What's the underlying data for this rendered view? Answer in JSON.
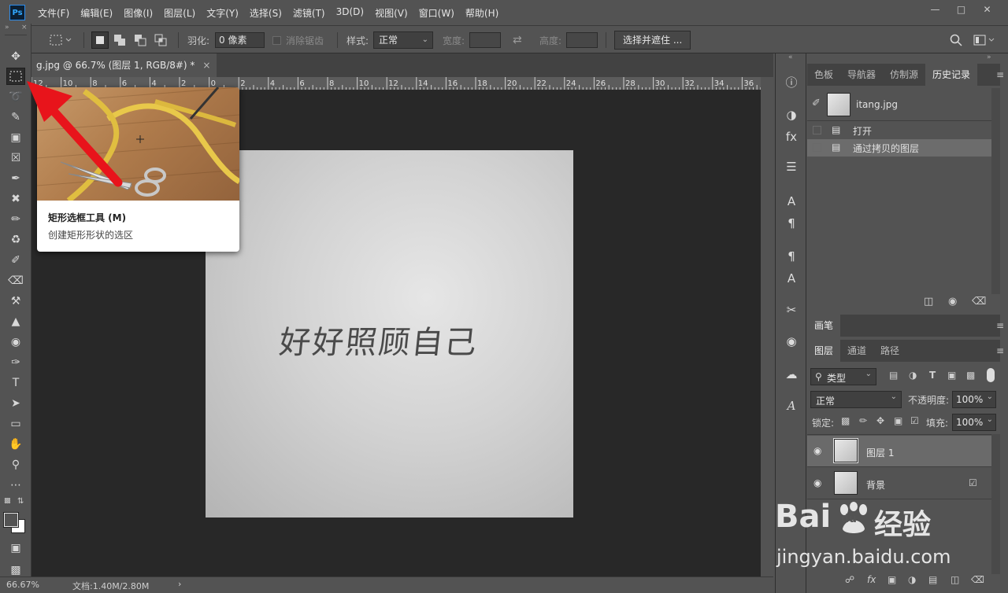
{
  "app": {
    "logo": "Ps",
    "menus": [
      "文件(F)",
      "编辑(E)",
      "图像(I)",
      "图层(L)",
      "文字(Y)",
      "选择(S)",
      "滤镜(T)",
      "3D(D)",
      "视图(V)",
      "窗口(W)",
      "帮助(H)"
    ]
  },
  "options": {
    "feather_label": "羽化:",
    "feather_value": "0 像素",
    "antialias_label": "消除锯齿",
    "style_label": "样式:",
    "style_value": "正常",
    "width_label": "宽度:",
    "height_label": "高度:",
    "select_mask_button": "选择并遮住 ..."
  },
  "document": {
    "tab_title": "g.jpg @ 66.7% (图层 1, RGB/8#) *",
    "close": "×",
    "ruler_numbers": [
      "12",
      "10",
      "8",
      "6",
      "4",
      "2",
      "0",
      "2",
      "4",
      "6",
      "8",
      "10",
      "12",
      "14",
      "16",
      "18",
      "20",
      "22",
      "24",
      "26",
      "28",
      "30",
      "32",
      "34",
      "36"
    ],
    "image_text": "好好照顾自己"
  },
  "tooltip": {
    "title": "矩形选框工具 (M)",
    "description": "创建矩形形状的选区"
  },
  "status": {
    "zoom": "66.67%",
    "doc_info": "文档:1.40M/2.80M"
  },
  "history_panel": {
    "tabs": [
      "色板",
      "导航器",
      "仿制源",
      "历史记录"
    ],
    "active_tab": "历史记录",
    "snapshot_name": "itang.jpg",
    "entries": [
      "打开",
      "通过拷贝的图层"
    ]
  },
  "brush_panel": {
    "tab": "画笔"
  },
  "layers_panel": {
    "tabs": [
      "图层",
      "通道",
      "路径"
    ],
    "filter_label": "类型",
    "blend_mode": "正常",
    "opacity_label": "不透明度:",
    "opacity_value": "100%",
    "lock_label": "锁定:",
    "fill_label": "填充:",
    "fill_value": "100%",
    "layers": [
      {
        "name": "图层 1",
        "locked": false
      },
      {
        "name": "背景",
        "locked": true
      }
    ]
  },
  "watermark": {
    "brand_cn": "经验",
    "brand_en": "Bai",
    "brand_du": "du",
    "url": "jingyan.baidu.com"
  },
  "colors": {
    "accent": "#e8141b",
    "panel_bg": "#535353",
    "canvas_bg": "#282828"
  }
}
